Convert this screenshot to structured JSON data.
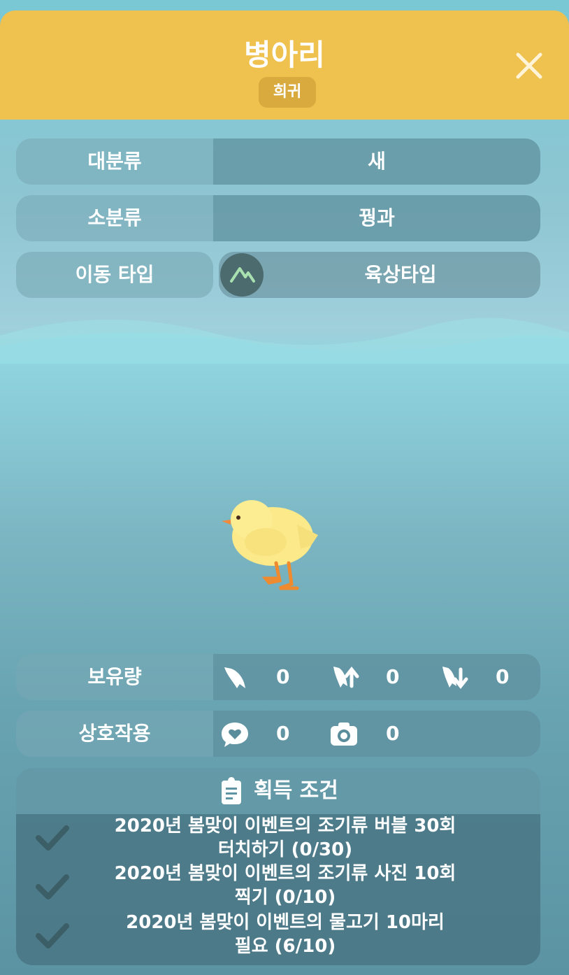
{
  "header": {
    "title": "병아리",
    "badge": "희귀"
  },
  "info": {
    "category_label": "대분류",
    "category_value": "새",
    "subcategory_label": "소분류",
    "subcategory_value": "꿩과",
    "move_label": "이동 타입",
    "move_value": "육상타입"
  },
  "holdings": {
    "label": "보유량",
    "fish": "0",
    "up": "0",
    "down": "0"
  },
  "interaction": {
    "label": "상호작용",
    "heart": "0",
    "photo": "0"
  },
  "conditions": {
    "title": "획득 조건",
    "items": [
      "2020년 봄맞이 이벤트의 조기류 버블 30회\n터치하기 (0/30)",
      "2020년 봄맞이 이벤트의 조기류 사진 10회\n찍기 (0/10)",
      "2020년 봄맞이 이벤트의 물고기 10마리\n필요 (6/10)"
    ]
  },
  "colors": {
    "header": "#efc14e",
    "badge": "#d9ab3e",
    "text": "#ffffff"
  }
}
